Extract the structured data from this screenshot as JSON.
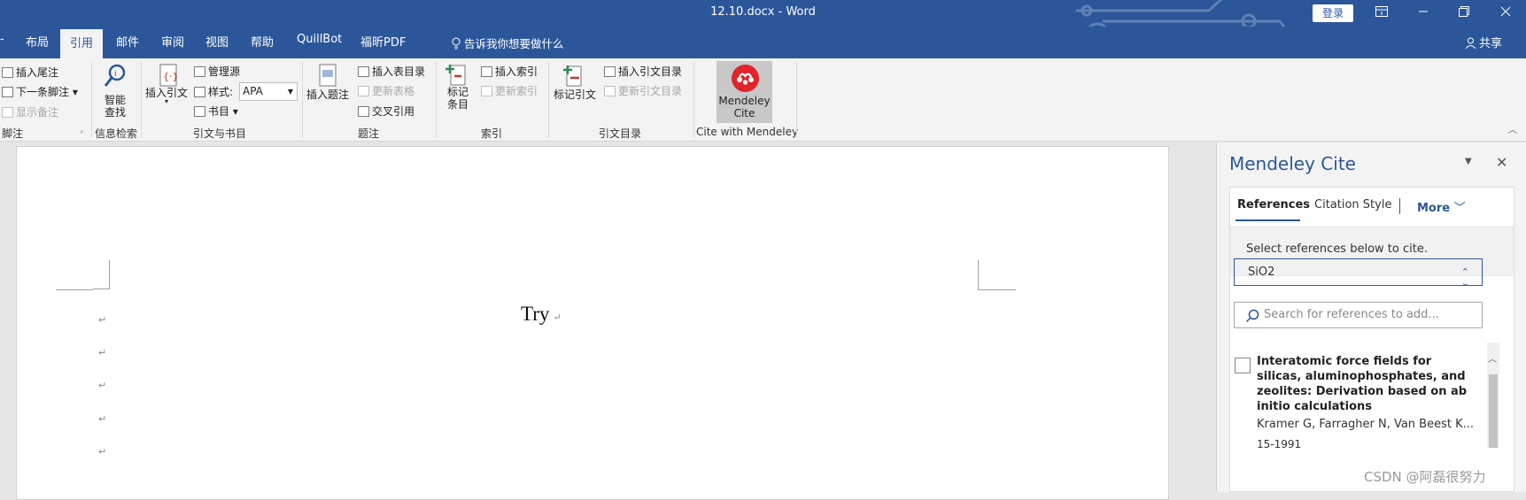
{
  "titlebar": {
    "title": "12.10.docx  -  Word",
    "login_label": "登录",
    "window_controls": [
      "ribbon-display-icon",
      "minimize-icon",
      "restore-icon",
      "close-icon"
    ],
    "color": "#2b579a"
  },
  "tabs": {
    "items": [
      "布局",
      "引用",
      "邮件",
      "审阅",
      "视图",
      "帮助",
      "QuillBot",
      "福昕PDF"
    ],
    "active": "引用",
    "tell_me": "告诉我你想要做什么",
    "share": "共享"
  },
  "ribbon": {
    "footnotes": {
      "insert_endnote": "插入尾注",
      "next_footnote": "下一条脚注",
      "show_notes": "显示备注",
      "group_label": "脚注"
    },
    "research": {
      "smart_lookup": [
        "智能",
        "查找"
      ],
      "group_label": "信息检索"
    },
    "citations": {
      "insert_citation": "插入引文",
      "manage_sources": "管理源",
      "style_label": "样式:",
      "style_value": "APA",
      "bibliography": "书目",
      "group_label": "引文与书目"
    },
    "captions": {
      "insert_caption": "插入题注",
      "insert_table_of_figures": "插入表目录",
      "update_table": "更新表格",
      "cross_reference": "交叉引用",
      "group_label": "题注"
    },
    "index": {
      "mark_entry": [
        "标记",
        "条目"
      ],
      "insert_index": "插入索引",
      "update_index": "更新索引",
      "group_label": "索引"
    },
    "toa": {
      "mark_citation": "标记引文",
      "insert_toa": "插入引文目录",
      "update_toa": "更新引文目录",
      "group_label": "引文目录"
    },
    "mendeley": {
      "button_label": [
        "Mendeley",
        "Cite"
      ],
      "group_label": "Cite with Mendeley",
      "brand_color": "#e0242a"
    }
  },
  "document": {
    "title_text": "Try",
    "paragraph_mark": "↵"
  },
  "mendeley_pane": {
    "title": "Mendeley Cite",
    "tabs": [
      "References",
      "Citation Style",
      "More"
    ],
    "active_tab": "References",
    "hint": "Select references below to cite.",
    "library_value": "SiO2",
    "search_placeholder": "Search for references to add...",
    "reference": {
      "title": "Interatomic force fields for silicas, aluminophosphates, and zeolites: Derivation based on ab initio calculations",
      "authors": "Kramer G, Farragher N, Van Beest K...",
      "year": "15-1991"
    }
  },
  "watermark": "CSDN @阿磊很努力"
}
